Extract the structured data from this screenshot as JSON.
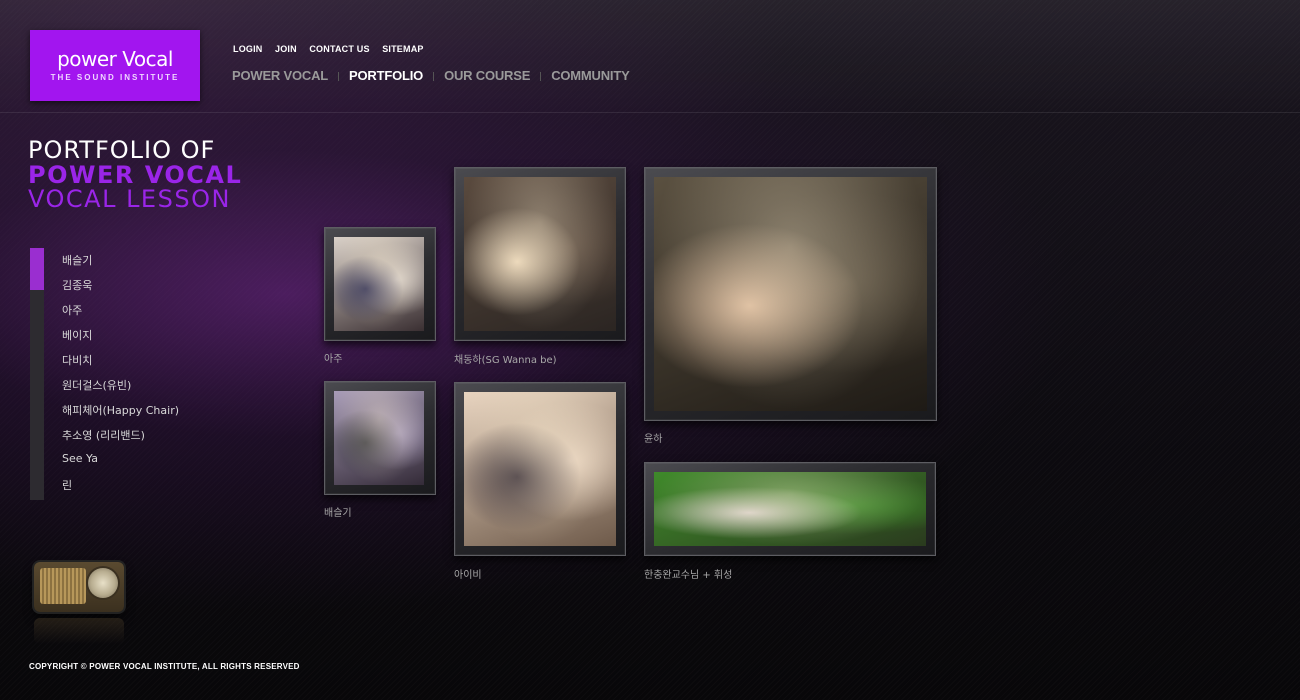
{
  "logo": {
    "main": "power Vocal",
    "sub": "THE SOUND INSTITUTE"
  },
  "util_nav": [
    "LOGIN",
    "JOIN",
    "CONTACT US",
    "SITEMAP"
  ],
  "main_nav": [
    {
      "label": "POWER VOCAL",
      "active": false
    },
    {
      "label": "PORTFOLIO",
      "active": true
    },
    {
      "label": "OUR COURSE",
      "active": false
    },
    {
      "label": "COMMUNITY",
      "active": false
    }
  ],
  "page_title": {
    "line1": "PORTFOLIO OF",
    "line2": "POWER VOCAL",
    "line3": "VOCAL LESSON"
  },
  "artists": [
    "배슬기",
    "김종욱",
    "아주",
    "베이지",
    "다비치",
    "원더걸스(유빈)",
    "해피체어(Happy Chair)",
    "추소영 (리리밴드)",
    "See Ya",
    "린"
  ],
  "artist_selected_index": 0,
  "photos": [
    {
      "caption": "아주",
      "colors": [
        "#3a2f32",
        "#d9d0c8",
        "#2a2a50"
      ]
    },
    {
      "caption": "채동하(SG Wanna be)",
      "colors": [
        "#2b2522",
        "#5a4a3e",
        "#e9d5b8"
      ]
    },
    {
      "caption": "윤하",
      "colors": [
        "#1e1a15",
        "#5a5040",
        "#d9b89a"
      ]
    },
    {
      "caption": "배슬기",
      "colors": [
        "#342b38",
        "#a89cb8",
        "#3a3a40"
      ]
    },
    {
      "caption": "아이비",
      "colors": [
        "#6e5a4a",
        "#e8d4c0",
        "#3a3038"
      ]
    },
    {
      "caption": "한충완교수님 + 휘성",
      "colors": [
        "#2a3a1e",
        "#3f8a2a",
        "#d8d0c8"
      ]
    }
  ],
  "copyright": "COPYRIGHT © POWER VOCAL INSTITUTE, ALL RIGHTS RESERVED",
  "accent_color": "#a215ef"
}
